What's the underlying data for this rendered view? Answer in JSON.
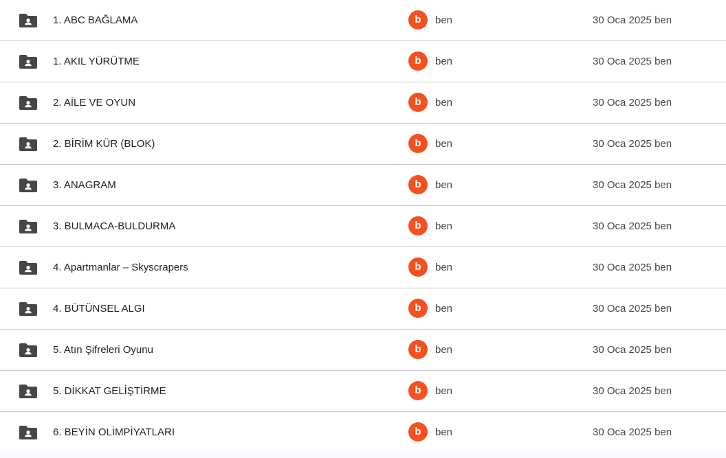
{
  "colors": {
    "avatar_bg": "#f4511e",
    "folder_icon": "#444746",
    "divider": "#c7c7c7"
  },
  "files": [
    {
      "name": "1. ABC BAĞLAMA",
      "icon": "shared-folder-icon",
      "avatar_letter": "b",
      "owner": "ben",
      "modified": "30 Oca 2025 ben"
    },
    {
      "name": "1. AKIL YÜRÜTME",
      "icon": "shared-folder-icon",
      "avatar_letter": "b",
      "owner": "ben",
      "modified": "30 Oca 2025 ben"
    },
    {
      "name": "2. AİLE VE OYUN",
      "icon": "shared-folder-icon",
      "avatar_letter": "b",
      "owner": "ben",
      "modified": "30 Oca 2025 ben"
    },
    {
      "name": "2. BİRİM KÜR (BLOK)",
      "icon": "shared-folder-icon",
      "avatar_letter": "b",
      "owner": "ben",
      "modified": "30 Oca 2025 ben"
    },
    {
      "name": "3. ANAGRAM",
      "icon": "shared-folder-icon",
      "avatar_letter": "b",
      "owner": "ben",
      "modified": "30 Oca 2025 ben"
    },
    {
      "name": "3. BULMACA-BULDURMA",
      "icon": "shared-folder-icon",
      "avatar_letter": "b",
      "owner": "ben",
      "modified": "30 Oca 2025 ben"
    },
    {
      "name": "4. Apartmanlar – Skyscrapers",
      "icon": "shared-folder-icon",
      "avatar_letter": "b",
      "owner": "ben",
      "modified": "30 Oca 2025 ben"
    },
    {
      "name": "4. BÜTÜNSEL ALGI",
      "icon": "shared-folder-icon",
      "avatar_letter": "b",
      "owner": "ben",
      "modified": "30 Oca 2025 ben"
    },
    {
      "name": "5. Atın Şifreleri Oyunu",
      "icon": "shared-folder-icon",
      "avatar_letter": "b",
      "owner": "ben",
      "modified": "30 Oca 2025 ben"
    },
    {
      "name": "5. DİKKAT GELİŞTİRME",
      "icon": "shared-folder-icon",
      "avatar_letter": "b",
      "owner": "ben",
      "modified": "30 Oca 2025 ben"
    },
    {
      "name": "6. BEYİN OLİMPİYATLARI",
      "icon": "shared-folder-icon",
      "avatar_letter": "b",
      "owner": "ben",
      "modified": "30 Oca 2025 ben"
    }
  ]
}
